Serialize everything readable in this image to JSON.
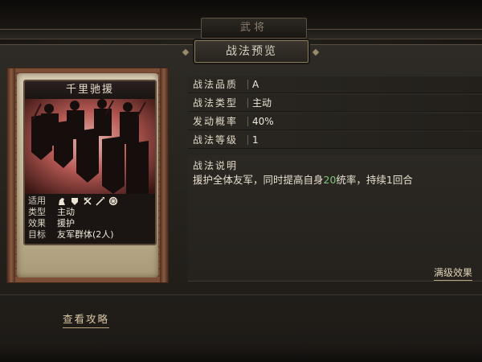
{
  "window": {
    "outer_title": "武将",
    "panel_title": "战法预览"
  },
  "card": {
    "name": "千里驰援",
    "info": [
      {
        "key": "适用",
        "value": ""
      },
      {
        "key": "类型",
        "value": "主动"
      },
      {
        "key": "效果",
        "value": "援护"
      },
      {
        "key": "目标",
        "value": "友军群体(2人)"
      }
    ],
    "applicable_icons": [
      "cavalry-icon",
      "shield-icon",
      "crossed-bows-icon",
      "spear-icon",
      "wheel-icon"
    ]
  },
  "attributes": [
    {
      "label": "战法品质",
      "value": "A"
    },
    {
      "label": "战法类型",
      "value": "主动"
    },
    {
      "label": "发动概率",
      "value": "40%"
    },
    {
      "label": "战法等级",
      "value": "1"
    }
  ],
  "description": {
    "title": "战法说明",
    "text_before": "援护全体友军，同时提高自身",
    "highlight": "20",
    "text_after": "统率，持续1回合"
  },
  "links": {
    "max_level": "满级效果",
    "guide": "查看攻略"
  },
  "colors": {
    "highlight": "#7fc47a",
    "text": "#e8e0cf",
    "card_border": "#5e4a3a"
  }
}
